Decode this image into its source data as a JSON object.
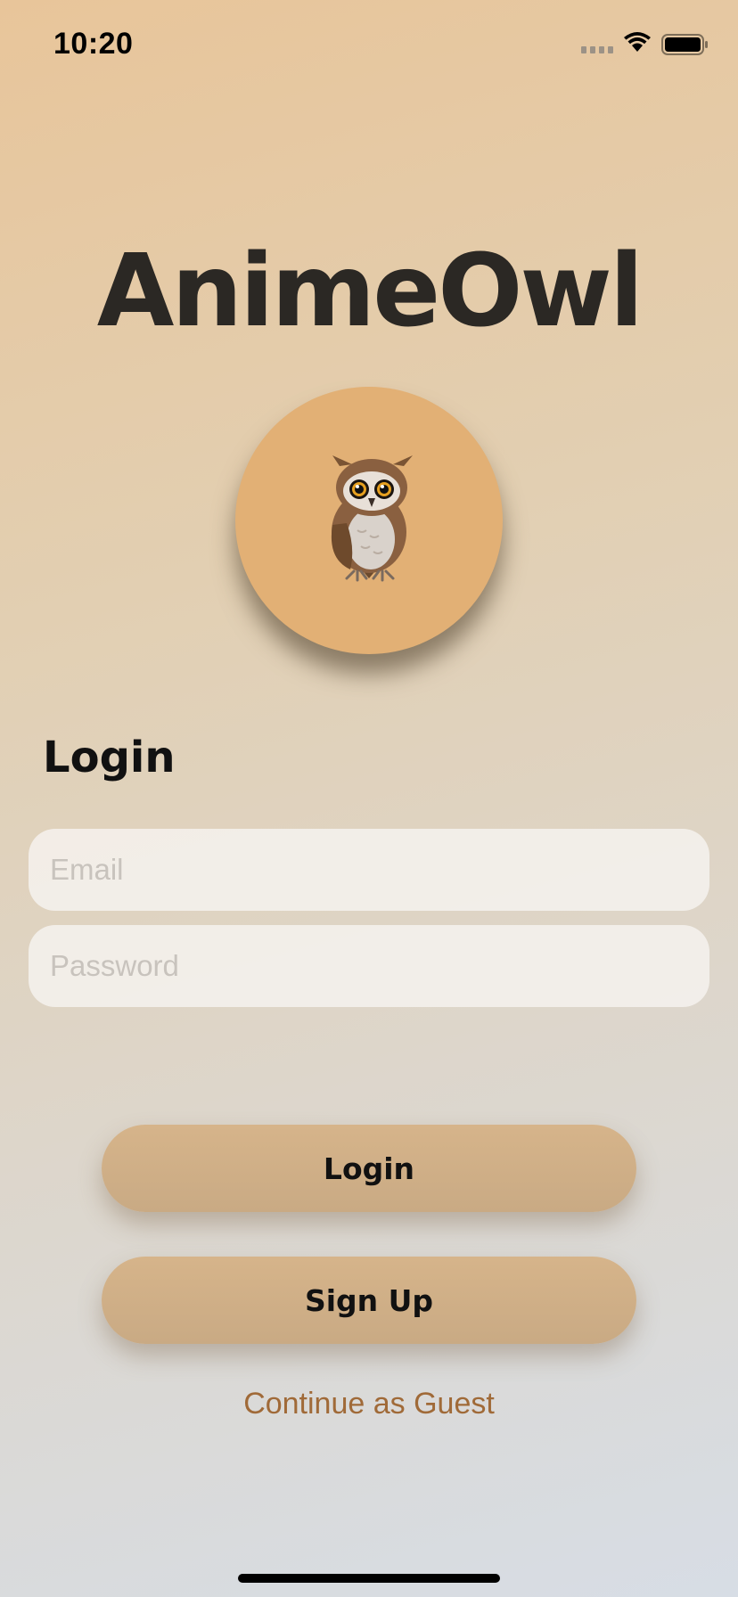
{
  "status_bar": {
    "time": "10:20",
    "signal_icon": "cellular-signal-icon",
    "wifi_icon": "wifi-icon",
    "battery_icon": "battery-icon"
  },
  "app": {
    "title": "AnimeOwl",
    "logo_icon": "owl-icon",
    "logo_color": "#e2b075"
  },
  "login_form": {
    "heading": "Login",
    "email_value": "",
    "email_placeholder": "Email",
    "password_value": "",
    "password_placeholder": "Password",
    "login_button": "Login",
    "signup_button": "Sign Up",
    "guest_link": "Continue as Guest"
  },
  "colors": {
    "button": "#cfae86",
    "link": "#a06a38",
    "title": "#2b2824"
  }
}
